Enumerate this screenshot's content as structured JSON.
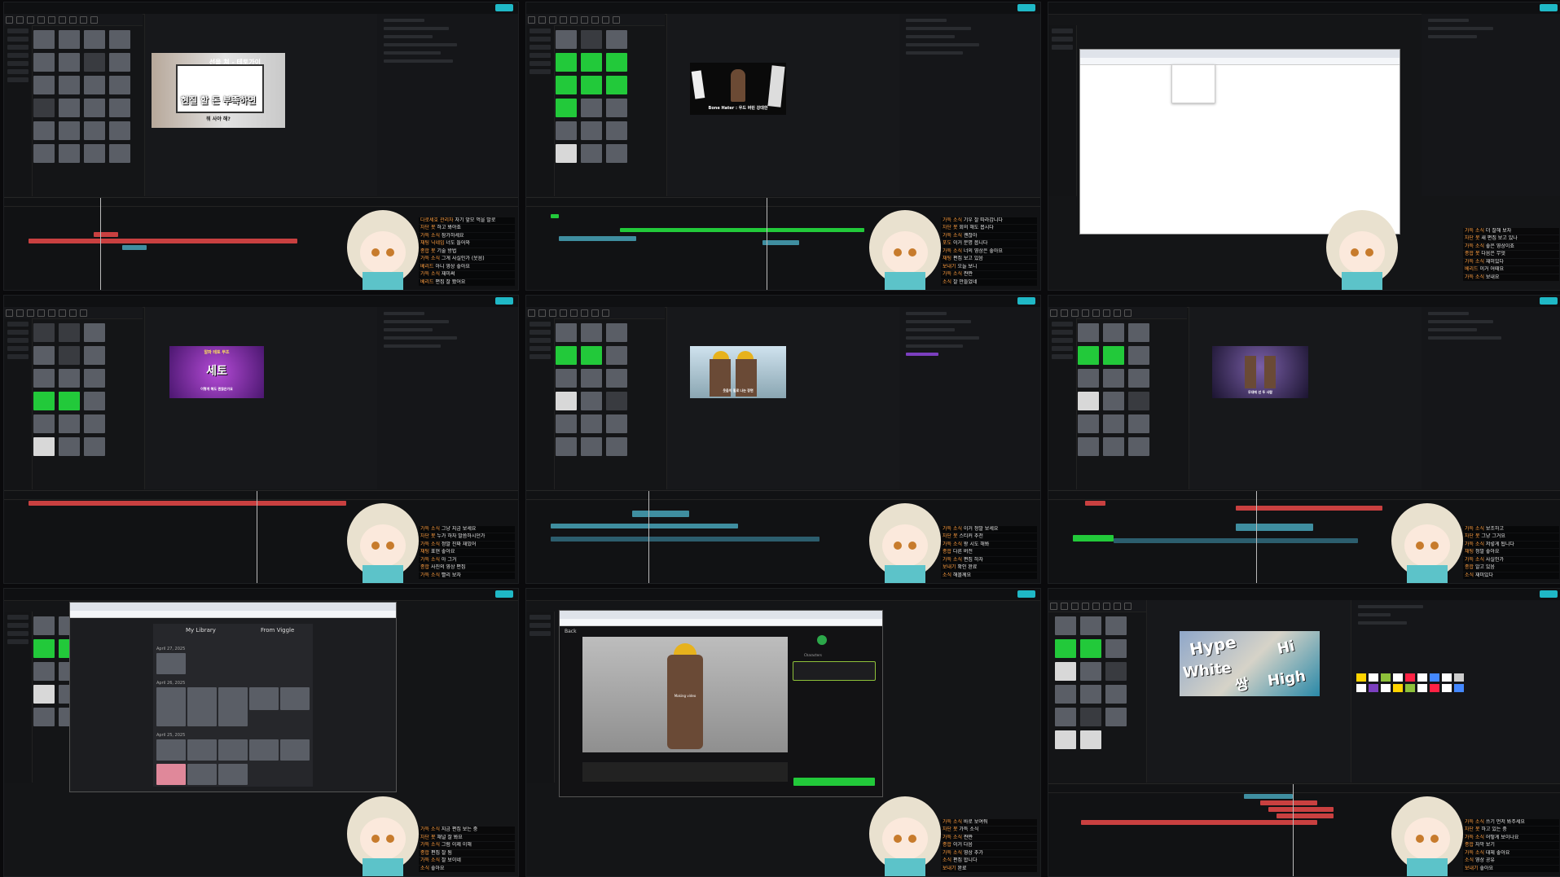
{
  "colors": {
    "accent": "#1fb8c6",
    "green_screen": "#22c93a",
    "track_red": "#c94040",
    "track_teal": "#3f8ea0",
    "chat_name": "#ff9e40"
  },
  "frames": [
    {
      "id": 1,
      "caption_top": "선을 쳐 - 테토가이",
      "caption_main": "현질 할 돈 부족하면",
      "caption_sub": "뭐 사야 해?",
      "chat": [
        [
          "다로세호 관리자",
          "자기 앞모 먹을 발로"
        ],
        [
          "차단 봇",
          "하고 봐야죠"
        ],
        [
          "가득 소식",
          "참가하세요"
        ],
        [
          "채팅 닉네임",
          "너도 들어와"
        ],
        [
          "종합 봇",
          "기술 방법"
        ],
        [
          "가득 소식",
          "그게 사실인가 (웃음)"
        ],
        [
          "베리드",
          "아니 영상 좋아요"
        ],
        [
          "가득 소식",
          "재미써"
        ],
        [
          "베리드",
          "편집 잘 봤어요"
        ]
      ]
    },
    {
      "id": 2,
      "caption_main": "Bone Hater : 우드 버린 강대한",
      "chat": [
        [
          "가득 소식",
          "기우 잘 따라갑니다"
        ],
        [
          "차단 봇",
          "회의 해도 봅시다"
        ],
        [
          "가득 소식",
          "괜찮아"
        ],
        [
          "포도",
          "이거 분명 봅니다"
        ],
        [
          "가득 소식",
          "너의 영상은 좋아요"
        ],
        [
          "채팅",
          "편집 보고 있음"
        ],
        [
          "보내기",
          "오늘 보니"
        ],
        [
          "가득 소식",
          "쨘쨘"
        ],
        [
          "소식",
          "잘 만들었네"
        ]
      ]
    },
    {
      "id": 3,
      "chat": [
        [
          "가득 소식",
          "더 잘해 보자"
        ],
        [
          "차단 봇",
          "새 편집 보고 있나"
        ],
        [
          "가득 소식",
          "좋은 영상이죠"
        ],
        [
          "종합 봇",
          "다음은 무엇"
        ],
        [
          "가득 소식",
          "재미있다"
        ],
        [
          "베리드",
          "이거 어때요"
        ],
        [
          "가득 소식",
          "보내요"
        ]
      ]
    },
    {
      "id": 4,
      "caption_top": "알파 테토 무조",
      "caption_main": "세토",
      "caption_sub": "이렇게 해도 괜찮은가요",
      "chat": [
        [
          "가득 소식",
          "그냥 지금 보세요"
        ],
        [
          "차단 봇",
          "누가 하자 말씀하시던가"
        ],
        [
          "가득 소식",
          "정말 진짜 재밌어"
        ],
        [
          "채팅",
          "표현 좋아요"
        ],
        [
          "가득 소식",
          "아 그거"
        ],
        [
          "종합",
          "사진의 영상 편집"
        ],
        [
          "가득 소식",
          "빨리 보자"
        ]
      ]
    },
    {
      "id": 5,
      "caption_main": "웃음이 절로 나는 장면",
      "chat": [
        [
          "가득 소식",
          "이거 정말 보세요"
        ],
        [
          "차단 봇",
          "스티커 추천"
        ],
        [
          "가득 소식",
          "왕 시도 해봐"
        ],
        [
          "종합",
          "다른 버전"
        ],
        [
          "가득 소식",
          "편집 하자"
        ],
        [
          "보내기",
          "확인 완료"
        ],
        [
          "소식",
          "해볼께요"
        ]
      ]
    },
    {
      "id": 6,
      "caption_main": "무대에 선 두 사람",
      "chat": [
        [
          "가득 소식",
          "보조하고"
        ],
        [
          "차단 봇",
          "그냥 그거요"
        ],
        [
          "가득 소식",
          "저렇게 됩니다"
        ],
        [
          "채팅",
          "정말 좋아요"
        ],
        [
          "가득 소식",
          "사실인가"
        ],
        [
          "종합",
          "알고 있음"
        ],
        [
          "소식",
          "재미있다"
        ]
      ]
    },
    {
      "id": 7,
      "lib_tab1": "My Library",
      "lib_tab2": "From Viggle",
      "dates": [
        "April 27, 2025",
        "April 26, 2025",
        "April 25, 2025"
      ],
      "chat": [
        [
          "가득 소식",
          "지금 편집 보는 중"
        ],
        [
          "차단 봇",
          "채널 잘 봐요"
        ],
        [
          "가득 소식",
          "그럼 이제 이해"
        ],
        [
          "종합",
          "편집 잘 됨"
        ],
        [
          "가득 소식",
          "잘 보이네"
        ],
        [
          "소식",
          "좋아요"
        ]
      ]
    },
    {
      "id": 8,
      "back_label": "Back",
      "panel_title": "Characters",
      "status": "Making video",
      "chat": [
        [
          "가득 소식",
          "바로 보여줘"
        ],
        [
          "차단 봇",
          "가득 소식"
        ],
        [
          "가득 소식",
          "쨘쨘"
        ],
        [
          "종합",
          "이거 다음"
        ],
        [
          "가득 소식",
          "영상 추가"
        ],
        [
          "소식",
          "편집 합니다"
        ],
        [
          "보내기",
          "완료"
        ]
      ]
    },
    {
      "id": 9,
      "words": [
        "Hype",
        "Hi",
        "White",
        "High",
        "쌍"
      ],
      "chat": [
        [
          "가득 소식",
          "쓰기 먼저 봐주세요"
        ],
        [
          "차단 봇",
          "하고 있는 중"
        ],
        [
          "가득 소식",
          "어떻게 보이나요"
        ],
        [
          "종합",
          "자막 보기"
        ],
        [
          "가득 소식",
          "대체 좋아요"
        ],
        [
          "소식",
          "영상 공유"
        ],
        [
          "보내기",
          "좋아요"
        ]
      ]
    }
  ]
}
